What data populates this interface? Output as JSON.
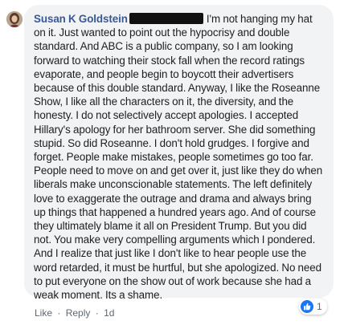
{
  "comment": {
    "author": "Susan K Goldstein",
    "author_suffix_redacted": true,
    "text": "I'm not hanging my hat on it. Just wanted to point out the hypocrisy and double standard. And ABC is a public company, so I am looking forward to watching their stock fall when the record ratings evaporate, and people begin to boycott their advertisers because of this double standard. Anyway, I like the Roseanne Show, I like all the characters on it, the diversity, and the honesty. I do not selectively accept apologies. I accepted Hillary's apology for her bathroom server. She did something stupid. So did Roseanne. I don't hold grudges. I forgive and forget. People make mistakes, people sometimes go too far. People need to move on and get over it, just like they do when liberals make unconscionable statements. The left definitely love to exaggerate the outrage and drama and always bring up things that happened a hundred years ago. And of course they ultimately blame it all on President Trump. But you did not. You make very compelling arguments which I pondered. And I realize that just like I don't like to hear people use the word retarded, it must be hurtful, but she apologized. No need to put everyone on the show out of work because she had a weak moment. Its a shame."
  },
  "actions": {
    "like": "Like",
    "separator": "·",
    "reply": "Reply",
    "time": "1d"
  },
  "reactions": {
    "icon": "thumbs-up-icon",
    "count": "1",
    "color": "#1877f2"
  },
  "colors": {
    "bubble": "#f2f3f5",
    "author": "#385898",
    "text": "#1c1e21",
    "meta": "#606770"
  }
}
